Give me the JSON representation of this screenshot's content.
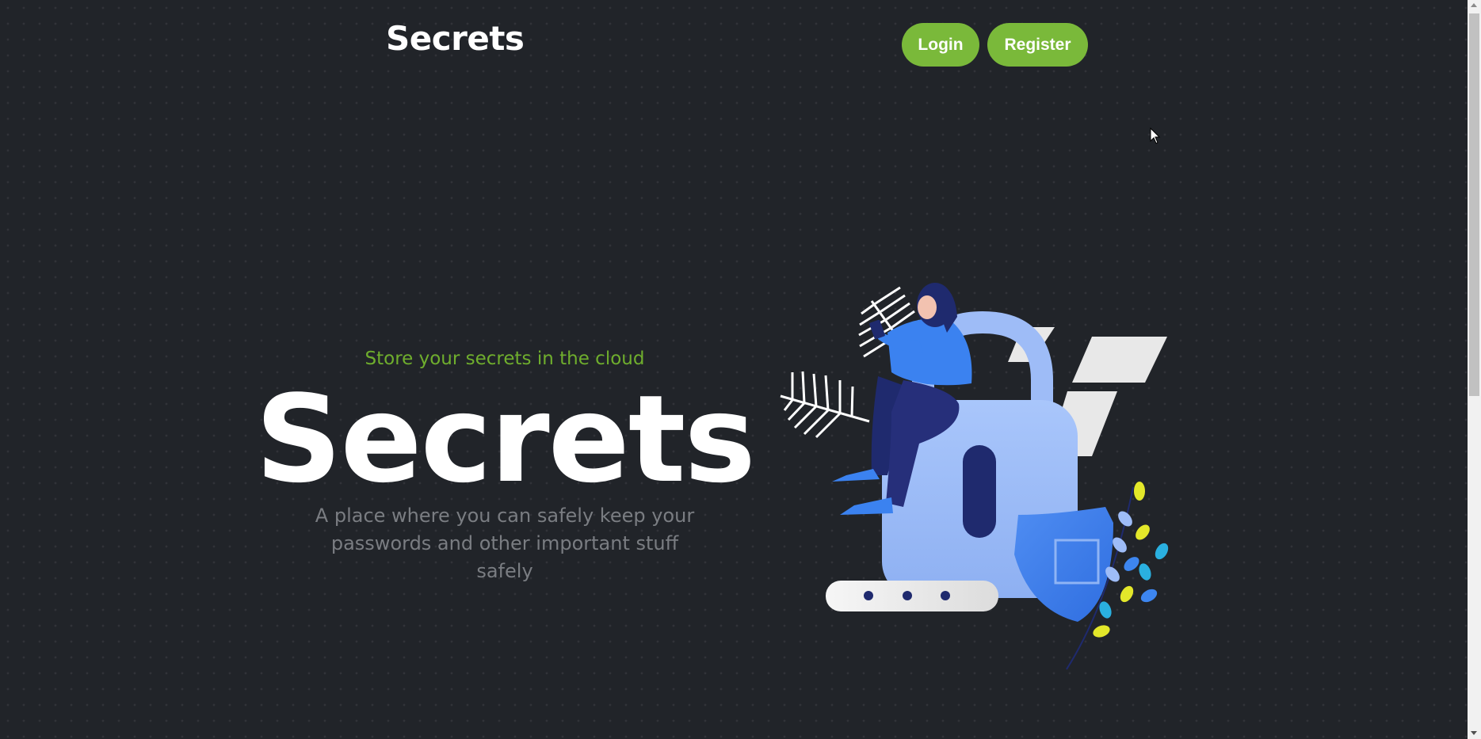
{
  "header": {
    "brand": "Secrets",
    "login_label": "Login",
    "register_label": "Register"
  },
  "hero": {
    "tagline": "Store your secrets in the cloud",
    "title": "Secrets",
    "description": "A place where you can safely keep your passwords and other important stuff safely"
  },
  "colors": {
    "background": "#212429",
    "accent": "#7ab93a",
    "tagline": "#6fae2d",
    "illustration_blue": "#9ebcf7",
    "illustration_navy": "#1f2a6e"
  },
  "icons": {
    "cursor": "mouse-pointer-icon",
    "illustration": "padlock-security-illustration"
  }
}
